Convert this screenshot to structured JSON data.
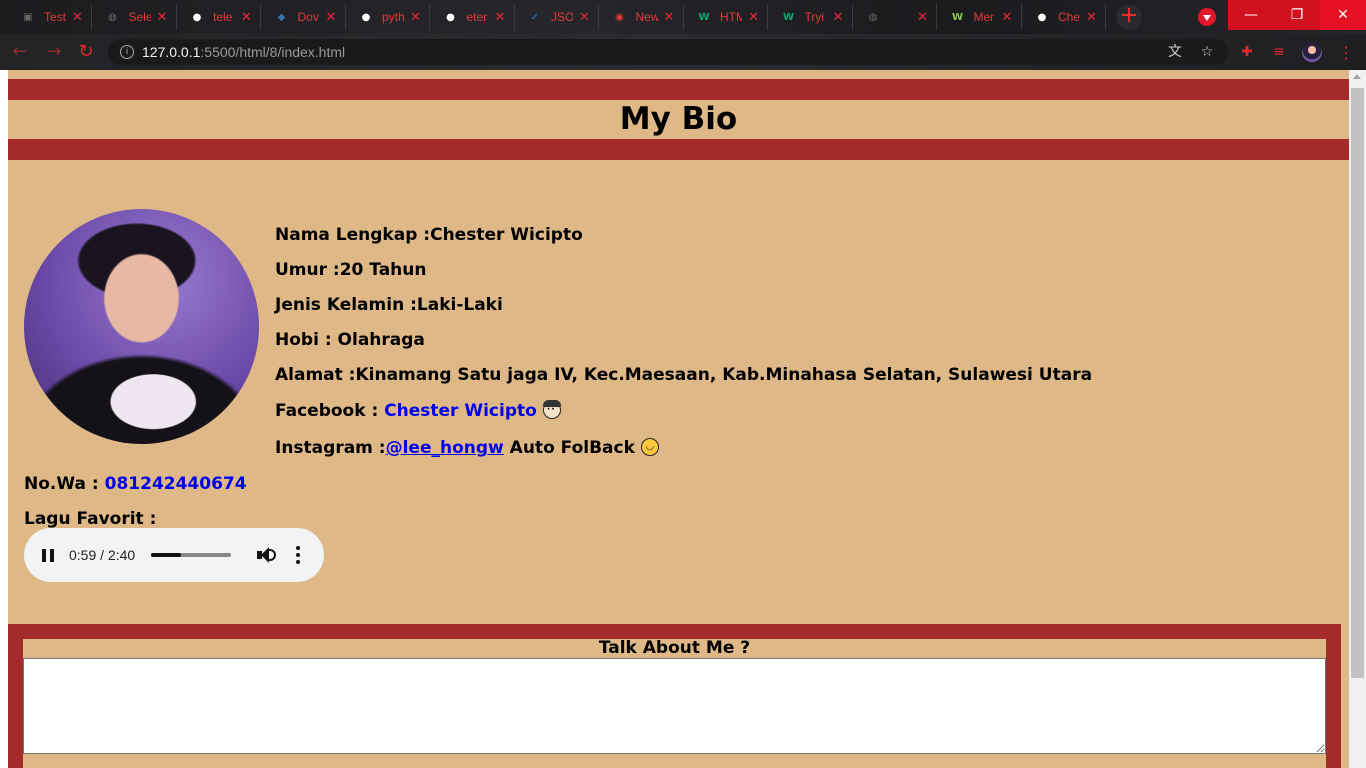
{
  "browser": {
    "tabs": [
      {
        "title": "Test",
        "icon": "image-icon",
        "color": "#6b6b6b"
      },
      {
        "title": "Sele",
        "icon": "globe-icon",
        "color": "#6b6b6b"
      },
      {
        "title": "tele",
        "icon": "github-icon",
        "color": "#ffffff"
      },
      {
        "title": "Dov",
        "icon": "python-icon",
        "color": "#3776ab"
      },
      {
        "title": "pyth",
        "icon": "github-icon",
        "color": "#ffffff"
      },
      {
        "title": "eter",
        "icon": "github-icon",
        "color": "#ffffff"
      },
      {
        "title": "JSO",
        "icon": "checkbox-icon",
        "color": "#1e88e5"
      },
      {
        "title": "New",
        "icon": "chrome-icon",
        "color": "#e53935"
      },
      {
        "title": "HTM",
        "icon": "w3-icon",
        "color": "#04aa6d"
      },
      {
        "title": "Tryi",
        "icon": "w3-icon",
        "color": "#04aa6d"
      },
      {
        "title": "",
        "icon": "globe-icon",
        "color": "#6b6b6b"
      },
      {
        "title": "Mer",
        "icon": "w-icon",
        "color": "#8bc34a"
      },
      {
        "title": "Che",
        "icon": "github-icon",
        "color": "#ffffff"
      }
    ],
    "url_host": "127.0.0.1",
    "url_path": ":5500/html/8/index.html"
  },
  "page": {
    "title": "My Bio",
    "bio": {
      "nama": "Nama Lengkap :Chester Wicipto",
      "umur": "Umur :20 Tahun",
      "kelamin": "Jenis Kelamin :Laki-Laki",
      "hobi": "Hobi : Olahraga",
      "alamat": "Alamat :Kinamang Satu jaga IV, Kec.Maesaan, Kab.Minahasa Selatan, Sulawesi Utara",
      "facebook_label": "Facebook : ",
      "facebook_link": "Chester Wicipto",
      "instagram_label": "Instagram :",
      "instagram_link": "@lee_hongw",
      "instagram_suffix": " Auto FolBack"
    },
    "wa_label": "No.Wa : ",
    "wa_number": "081242440674",
    "lagu_label": "Lagu Favorit :",
    "audio": {
      "time": "0:59 / 2:40",
      "progress": 0.37
    },
    "talk_title": "Talk About Me ?",
    "talk_value": ""
  },
  "colors": {
    "background": "#deb887",
    "bar": "#a52a2a",
    "link": "#0000ee"
  }
}
